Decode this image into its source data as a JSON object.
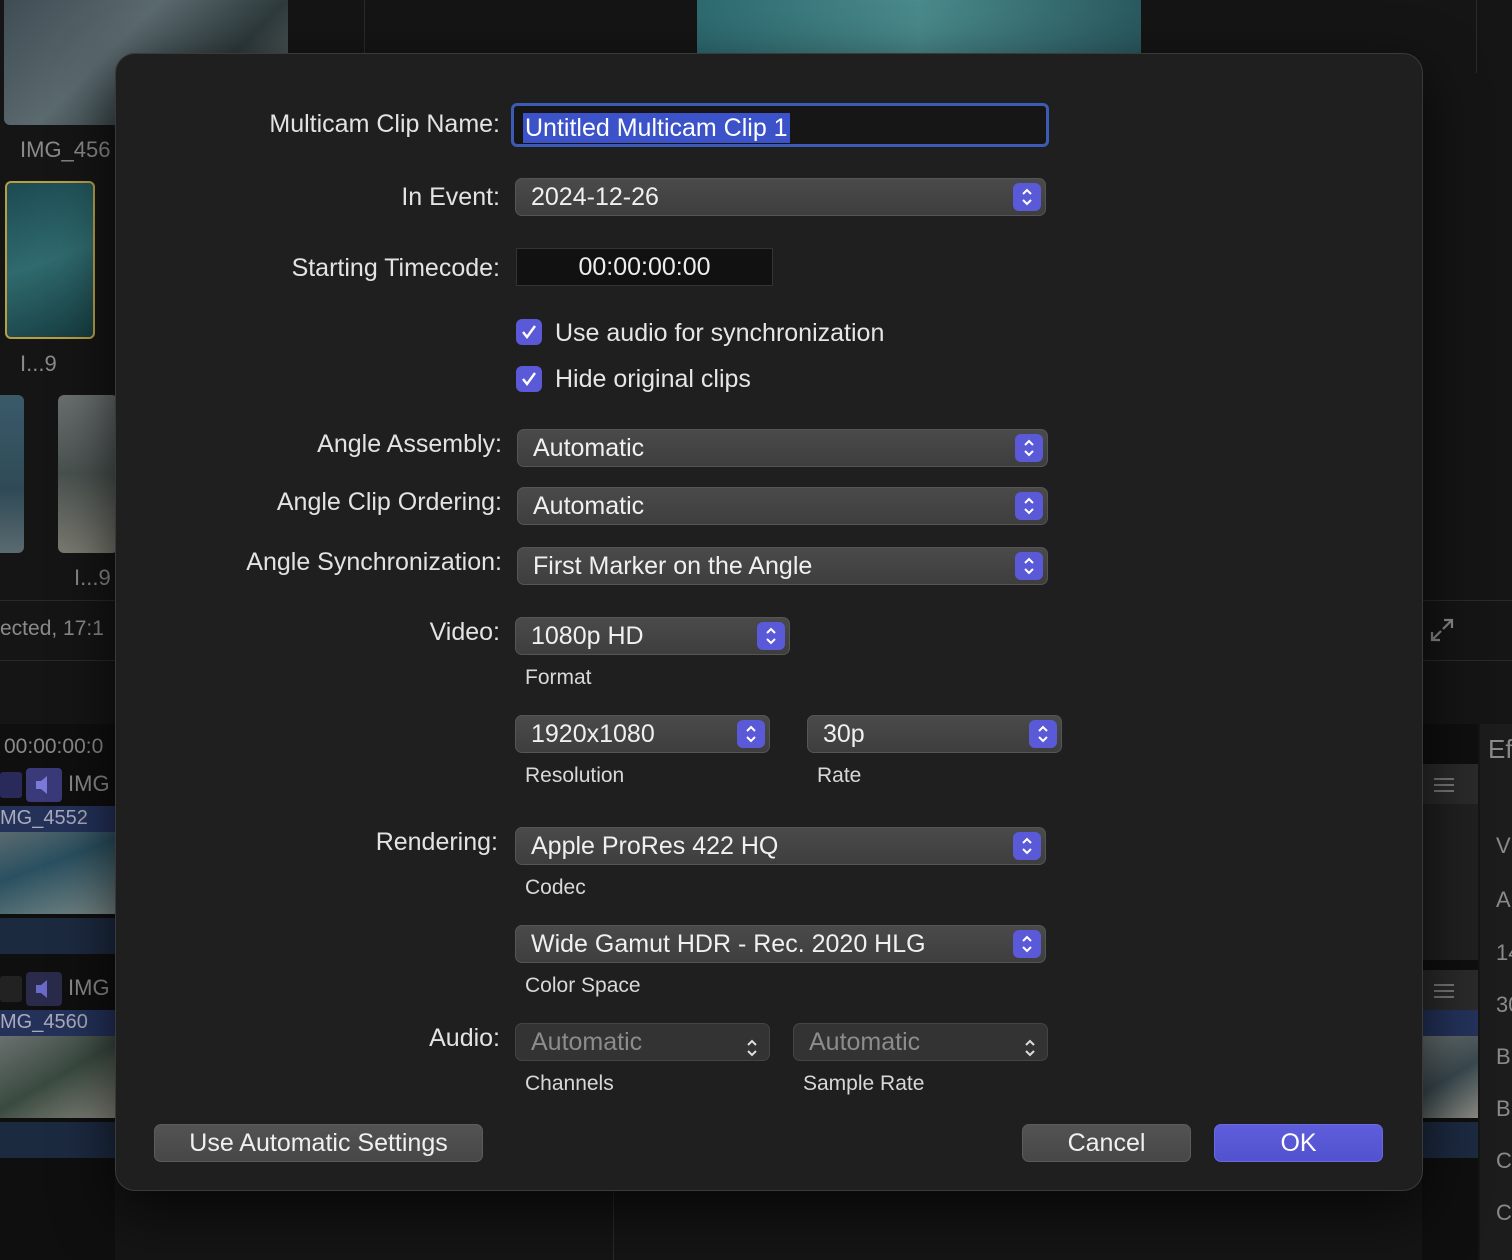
{
  "background": {
    "browser_labels": [
      "IMG_456",
      "I...9",
      "I...9"
    ],
    "status_text": "ected, 17:1",
    "timeline_timecode": "00:00:00:0",
    "clip_header": "IMG",
    "clips": [
      "MG_4552",
      "MG_4560"
    ],
    "inspector_tab": "Ef",
    "inspector_letters": [
      "V",
      "A",
      "14",
      "30",
      "B",
      "B",
      "C",
      "C"
    ]
  },
  "dialog": {
    "clip_name_label": "Multicam Clip Name:",
    "clip_name_value": "Untitled Multicam Clip 1",
    "event_label": "In Event:",
    "event_value": "2024-12-26",
    "timecode_label": "Starting Timecode:",
    "timecode_value": "00:00:00:00",
    "use_audio_label": "Use audio for synchronization",
    "use_audio_checked": true,
    "hide_clips_label": "Hide original clips",
    "hide_clips_checked": true,
    "angle_assembly_label": "Angle Assembly:",
    "angle_assembly_value": "Automatic",
    "angle_ordering_label": "Angle Clip Ordering:",
    "angle_ordering_value": "Automatic",
    "angle_sync_label": "Angle Synchronization:",
    "angle_sync_value": "First Marker on the Angle",
    "video_label": "Video:",
    "format_value": "1080p HD",
    "format_caption": "Format",
    "resolution_value": "1920x1080",
    "resolution_caption": "Resolution",
    "rate_value": "30p",
    "rate_caption": "Rate",
    "rendering_label": "Rendering:",
    "codec_value": "Apple ProRes 422 HQ",
    "codec_caption": "Codec",
    "color_space_value": "Wide Gamut HDR - Rec. 2020 HLG",
    "color_space_caption": "Color Space",
    "audio_label": "Audio:",
    "channels_value": "Automatic",
    "channels_caption": "Channels",
    "sample_rate_value": "Automatic",
    "sample_rate_caption": "Sample Rate",
    "auto_settings_button": "Use Automatic Settings",
    "cancel_button": "Cancel",
    "ok_button": "OK"
  },
  "colors": {
    "accent": "#5a5ad8",
    "selection": "#3b52c9",
    "dialog_bg": "#1f1f1f"
  }
}
